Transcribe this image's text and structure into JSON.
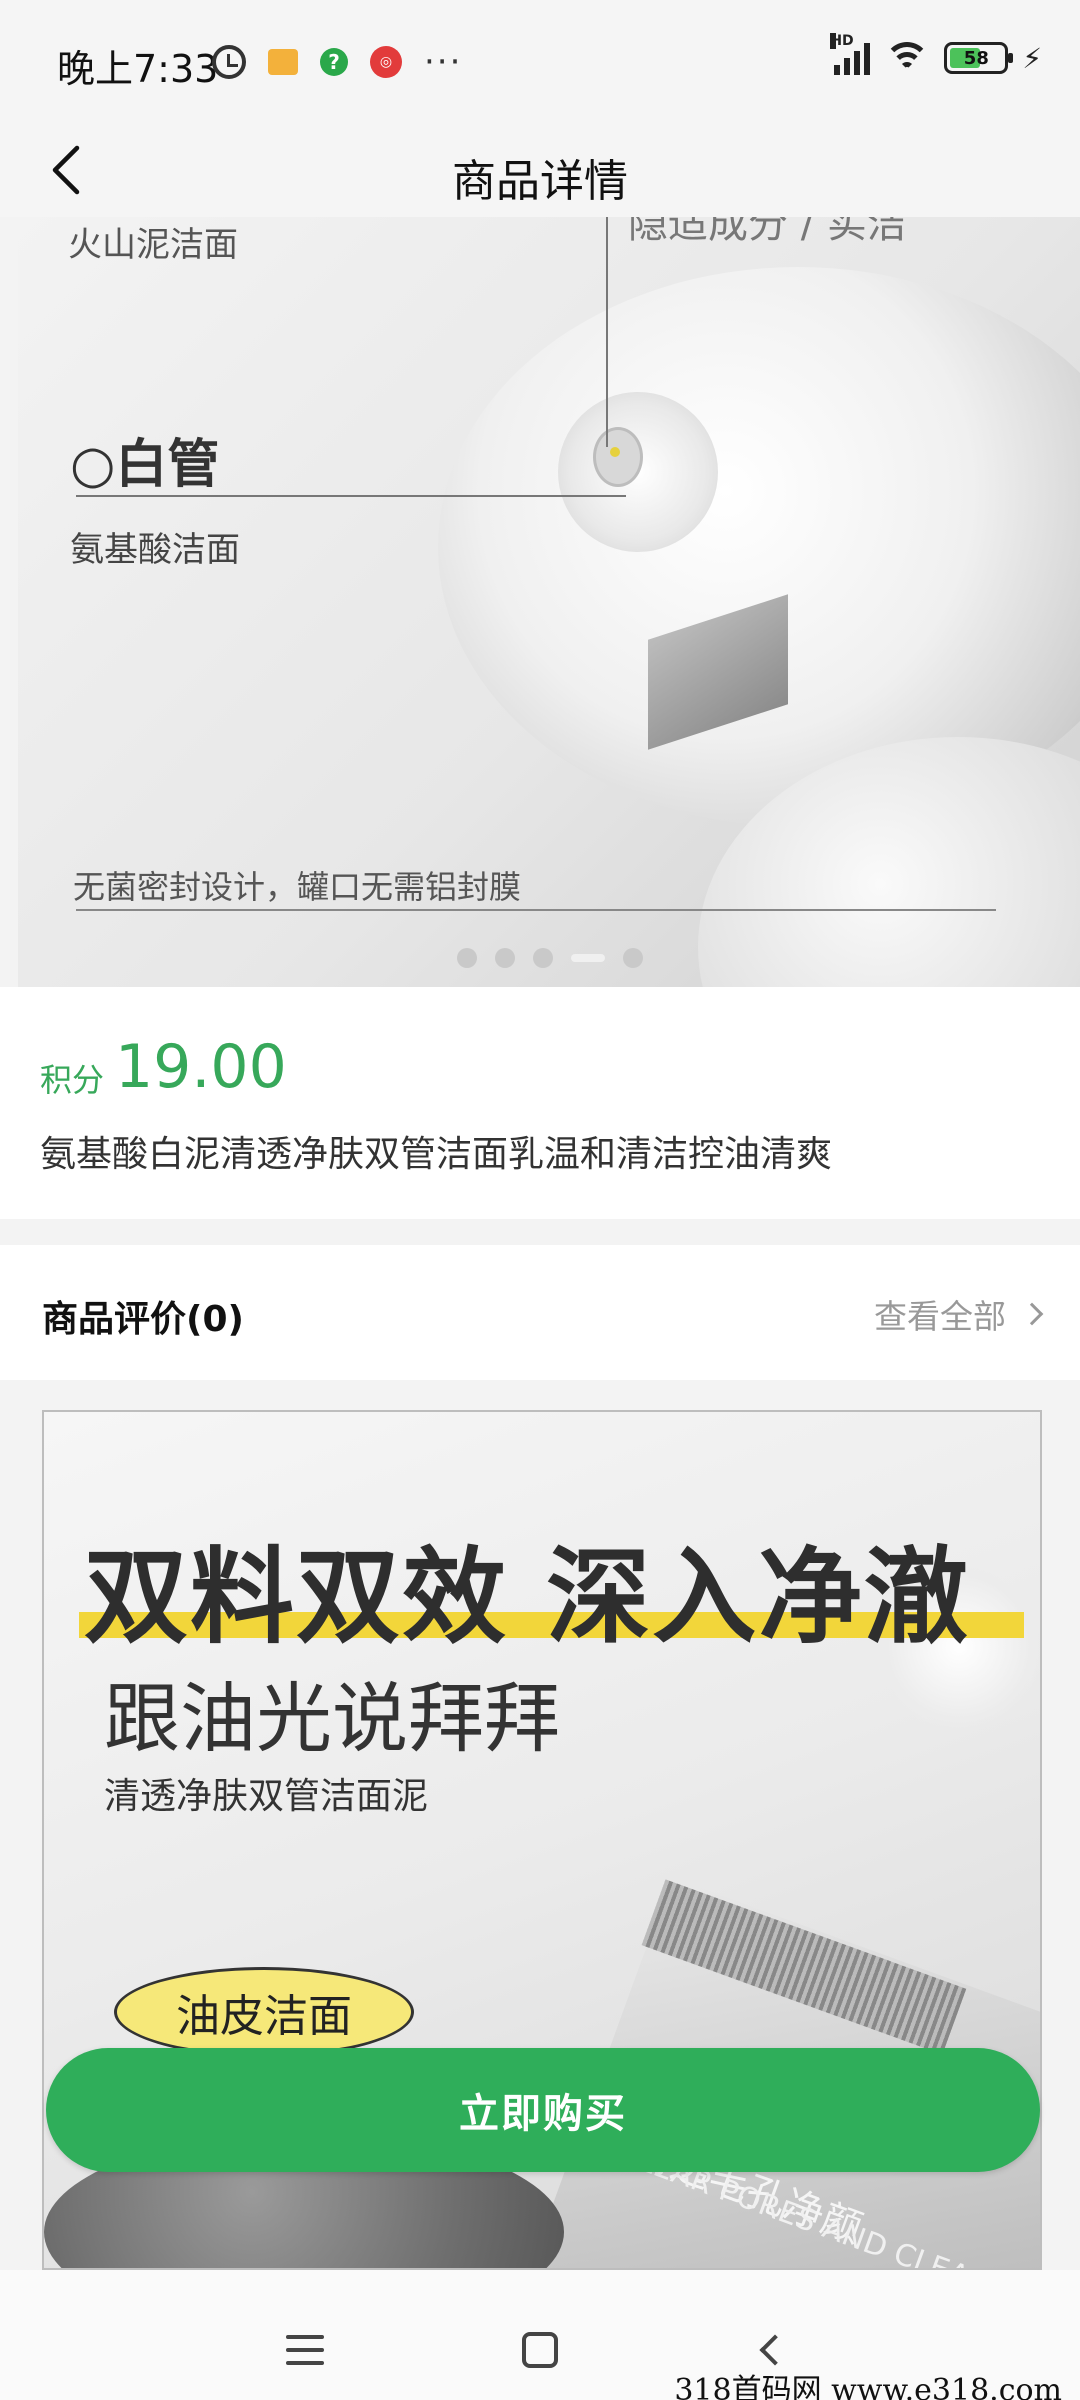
{
  "status_bar": {
    "time": "晚上7:33",
    "more": "···",
    "network_label": "HD",
    "battery_level": "58",
    "icons": [
      "alarm-icon",
      "message-icon",
      "help-icon",
      "app-badge-icon",
      "signal-icon",
      "wifi-icon",
      "battery-icon",
      "charging-icon"
    ]
  },
  "nav": {
    "title": "商品详情",
    "back_icon": "chevron-left-icon"
  },
  "hero": {
    "label_top": "火山泥洁面",
    "label_top_clipped": "隐适成分 / 实洁",
    "label_main": "○白管",
    "label_sub": "氨基酸洁面",
    "label_bottom": "无菌密封设计，罐口无需铝封膜",
    "carousel_count": 5,
    "carousel_active_index": 3
  },
  "product": {
    "price_prefix": "积分",
    "price": "19.00",
    "title": "氨基酸白泥清透净肤双管洁面乳温和清洁控油清爽",
    "price_color": "#37a85a"
  },
  "reviews": {
    "title": "商品评价(0)",
    "view_all": "查看全部"
  },
  "detail": {
    "headline": "双料双效 深入净澈",
    "subhead": "跟油光说拜拜",
    "small": "清透净肤双管洁面泥",
    "badge": "油皮洁面",
    "tube_text": "清透毛孔净颜",
    "tube_text_en": "CLEAR PORES AND CLEANSE SKIN"
  },
  "buy_button": {
    "label": "立即购买",
    "color": "#2fae5a"
  },
  "watermark": "318首码网  www.e318.com"
}
